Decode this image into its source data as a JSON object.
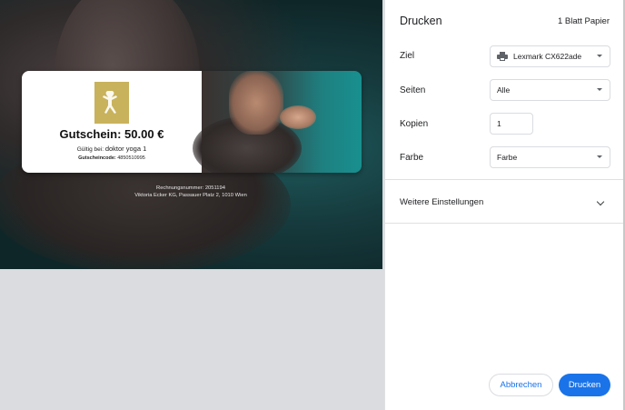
{
  "dialog": {
    "title": "Drucken",
    "sheet_count": "1 Blatt Papier",
    "destination_label": "Ziel",
    "destination_value": "Lexmark CX622ade",
    "pages_label": "Seiten",
    "pages_value": "Alle",
    "copies_label": "Kopien",
    "copies_value": "1",
    "color_label": "Farbe",
    "color_value": "Farbe",
    "more_settings": "Weitere Einstellungen",
    "cancel_label": "Abbrechen",
    "print_label": "Drucken"
  },
  "preview": {
    "voucher_title": "Gutschein:  50.00 €",
    "valid_prefix": "Gültig bei: ",
    "valid_value": "doktor yoga 1",
    "code_label": "Gutscheincode:",
    "code_value": " 4850510995",
    "invoice_line": "Rechnungsnummer: 2051194",
    "address_line": "Viktoria Ecker KG, Passauer Platz 2, 1010 Wien"
  },
  "colors": {
    "accent": "#1a73e8",
    "logo_gold": "#c8b25c"
  },
  "icons": [
    "printer-icon",
    "chevron-down-icon",
    "logo-icon"
  ]
}
